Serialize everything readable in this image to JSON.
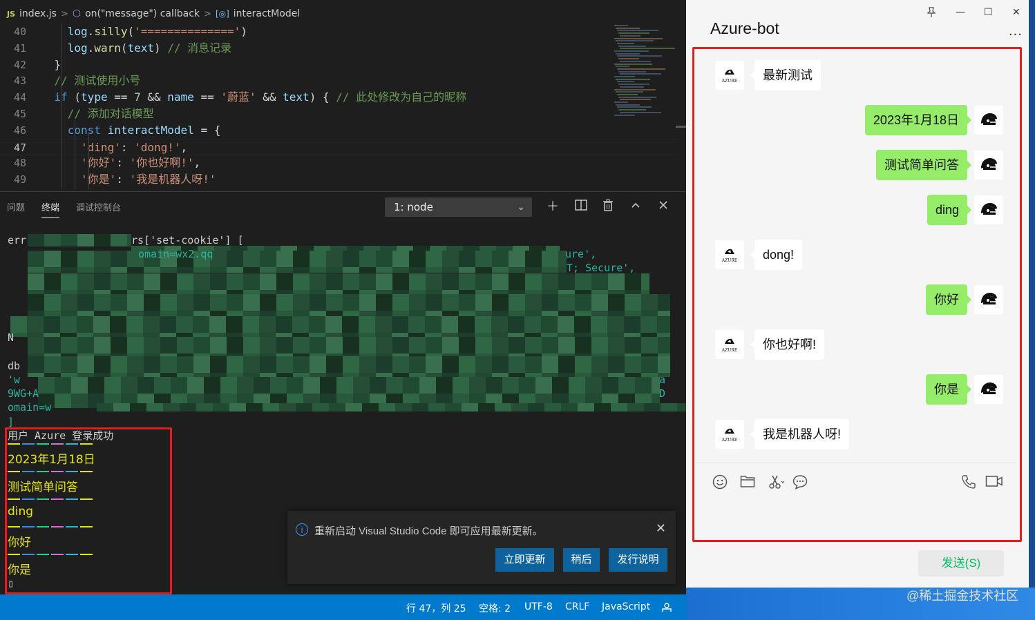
{
  "breadcrumb": {
    "file_icon": "JS",
    "file": "index.js",
    "sep": ">",
    "callback": "on(\"message\") callback",
    "symbol": "interactModel"
  },
  "editor": {
    "lines": [
      {
        "num": "40",
        "tokens": [
          {
            "t": "log",
            "c": "v"
          },
          {
            "t": ".",
            "c": "o"
          },
          {
            "t": "silly",
            "c": "f"
          },
          {
            "t": "(",
            "c": "o"
          },
          {
            "t": "'=============='",
            "c": "s"
          },
          {
            "t": ")",
            "c": "o"
          }
        ],
        "indent": 6
      },
      {
        "num": "41",
        "tokens": [
          {
            "t": "log",
            "c": "v"
          },
          {
            "t": ".",
            "c": "o"
          },
          {
            "t": "warn",
            "c": "f"
          },
          {
            "t": "(",
            "c": "o"
          },
          {
            "t": "text",
            "c": "v"
          },
          {
            "t": ") ",
            "c": "o"
          },
          {
            "t": "// 消息记录",
            "c": "c"
          }
        ],
        "indent": 6
      },
      {
        "num": "42",
        "tokens": [
          {
            "t": "}",
            "c": "o"
          }
        ],
        "indent": 4
      },
      {
        "num": "43",
        "tokens": [
          {
            "t": "// 测试使用小号",
            "c": "c"
          }
        ],
        "indent": 4
      },
      {
        "num": "44",
        "tokens": [
          {
            "t": "if",
            "c": "k"
          },
          {
            "t": " (",
            "c": "o"
          },
          {
            "t": "type",
            "c": "v"
          },
          {
            "t": " == ",
            "c": "o"
          },
          {
            "t": "7",
            "c": "n"
          },
          {
            "t": " && ",
            "c": "o"
          },
          {
            "t": "name",
            "c": "v"
          },
          {
            "t": " == ",
            "c": "o"
          },
          {
            "t": "'蔚蓝'",
            "c": "s"
          },
          {
            "t": " && ",
            "c": "o"
          },
          {
            "t": "text",
            "c": "v"
          },
          {
            "t": ") { ",
            "c": "o"
          },
          {
            "t": "// 此处修改为自己的昵称",
            "c": "c"
          }
        ],
        "indent": 4
      },
      {
        "num": "45",
        "tokens": [
          {
            "t": "// 添加对话模型",
            "c": "c"
          }
        ],
        "indent": 6
      },
      {
        "num": "46",
        "tokens": [
          {
            "t": "const",
            "c": "k"
          },
          {
            "t": " ",
            "c": "o"
          },
          {
            "t": "interactModel",
            "c": "v"
          },
          {
            "t": " = {",
            "c": "o"
          }
        ],
        "indent": 6
      },
      {
        "num": "47",
        "tokens": [
          {
            "t": "'ding'",
            "c": "s"
          },
          {
            "t": ": ",
            "c": "o"
          },
          {
            "t": "'dong!'",
            "c": "s"
          },
          {
            "t": ",",
            "c": "o"
          }
        ],
        "indent": 8
      },
      {
        "num": "48",
        "tokens": [
          {
            "t": "'你好'",
            "c": "s"
          },
          {
            "t": ": ",
            "c": "o"
          },
          {
            "t": "'你也好啊!'",
            "c": "s"
          },
          {
            "t": ",",
            "c": "o"
          }
        ],
        "indent": 8
      },
      {
        "num": "49",
        "tokens": [
          {
            "t": "'你是'",
            "c": "s"
          },
          {
            "t": ": ",
            "c": "o"
          },
          {
            "t": "'我是机器人呀!'",
            "c": "s"
          }
        ],
        "indent": 8
      }
    ],
    "active_line": "47"
  },
  "panel": {
    "tabs": [
      "问题",
      "终端",
      "调试控制台"
    ],
    "active_tab": "终端",
    "terminal_select": "1: node",
    "icons": [
      "plus-icon",
      "split-icon",
      "trash-icon",
      "chevron-up-icon",
      "close-icon"
    ]
  },
  "terminal": {
    "visible_fragments": [
      {
        "text": "err",
        "row": 0
      },
      {
        "text": "rs['set-cookie'] [",
        "row": 0
      },
      {
        "text": "omain=wx2.qq",
        "row": 1
      },
      {
        "text": "ure',",
        "row": 1
      },
      {
        "text": "T; Secure',",
        "row": 2
      },
      {
        "text": "N",
        "row": 7
      },
      {
        "text": "db",
        "row": 9
      },
      {
        "text": "'w",
        "row": 10
      },
      {
        "text": "9WG+A",
        "row": 11
      },
      {
        "text": "omain=w",
        "row": 12
      },
      {
        "text": "]",
        "row": 13
      }
    ],
    "login_line": "用户 Azure 登录成功",
    "messages": [
      "2023年1月18日",
      "测试简单问答",
      "ding",
      "你好",
      "你是"
    ],
    "cursor": "▯",
    "separator_colors": [
      "#e5e510",
      "#3b8eea",
      "#23d18b",
      "#d670d6",
      "#29b8db",
      "#e5e510"
    ]
  },
  "notification": {
    "message": "重新启动 Visual Studio Code 即可应用最新更新。",
    "buttons": [
      "立即更新",
      "稍后",
      "发行说明"
    ]
  },
  "statusbar": {
    "position": "行 47，列 25",
    "spaces": "空格: 2",
    "encoding": "UTF-8",
    "eol": "CRLF",
    "language": "JavaScript"
  },
  "chat": {
    "title": "Azure-bot",
    "window_controls": [
      "pin-icon",
      "minimize-icon",
      "maximize-icon",
      "close-icon"
    ],
    "more": "···",
    "messages": [
      {
        "from": "bot",
        "text": "最新测试"
      },
      {
        "from": "me",
        "text": "2023年1月18日"
      },
      {
        "from": "me",
        "text": "测试简单问答"
      },
      {
        "from": "me",
        "text": "ding"
      },
      {
        "from": "bot",
        "text": "dong!"
      },
      {
        "from": "me",
        "text": "你好"
      },
      {
        "from": "bot",
        "text": "你也好啊!"
      },
      {
        "from": "me",
        "text": "你是"
      },
      {
        "from": "bot",
        "text": "我是机器人呀!"
      }
    ],
    "bot_avatar_label": "Azure",
    "toolbar_icons": [
      "emoji-icon",
      "folder-icon",
      "scissors-icon",
      "chat-bubble-icon",
      "phone-icon",
      "video-icon"
    ],
    "send_label": "发送(S)"
  },
  "watermark": "@稀土掘金技术社区",
  "colors": {
    "accent": "#007acc",
    "bubble_me": "#95ec69",
    "highlight_box": "#e02020"
  }
}
